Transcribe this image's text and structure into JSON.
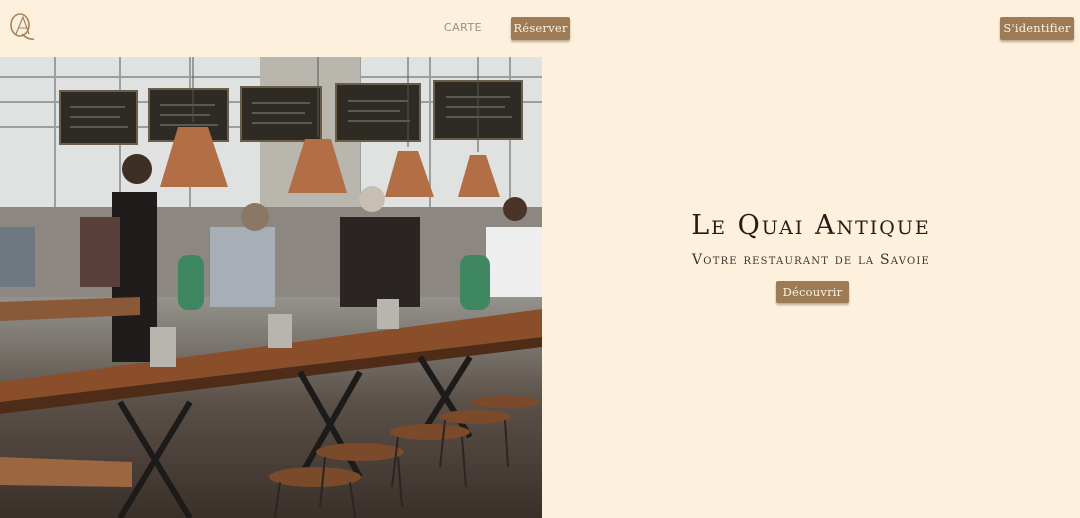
{
  "header": {
    "logo_text": "QA",
    "nav_menu_label": "CARTE",
    "reserve_label": "Réserver",
    "login_label": "S'identifier"
  },
  "hero": {
    "title": "Le Quai Antique",
    "subtitle": "Votre restaurant de la Savoie",
    "discover_label": "Découvrir"
  },
  "colors": {
    "background": "#fdf1dd",
    "button": "#9d7b55",
    "button_text": "#fbf3e6",
    "title_text": "#231d18",
    "nav_text": "#9a8e80"
  }
}
